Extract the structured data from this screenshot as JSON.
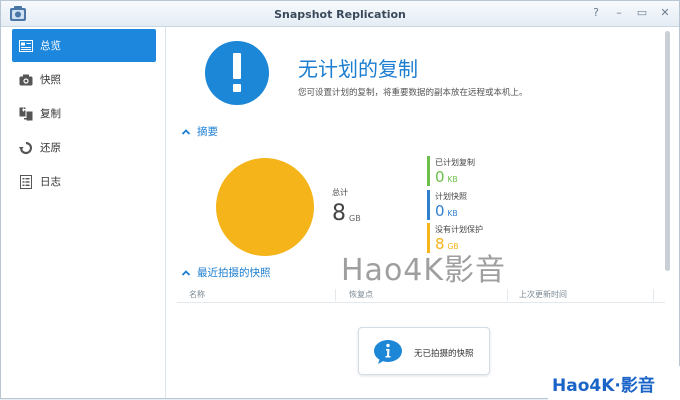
{
  "window": {
    "title": "Snapshot Replication"
  },
  "sidebar": {
    "items": [
      {
        "label": "总览",
        "icon": "overview-icon",
        "active": true
      },
      {
        "label": "快照",
        "icon": "camera-icon"
      },
      {
        "label": "复制",
        "icon": "replication-icon"
      },
      {
        "label": "还原",
        "icon": "restore-icon"
      },
      {
        "label": "日志",
        "icon": "log-icon"
      }
    ]
  },
  "hero": {
    "title": "无计划的复制",
    "subtitle": "您可设置计划的复制，将重要数据的副本放在远程或本机上。"
  },
  "summary": {
    "heading": "摘要",
    "total_label": "总计",
    "total_value": "8",
    "total_unit": "GB",
    "legend": [
      {
        "label": "已计划复制",
        "value": "0",
        "unit": "KB",
        "color": "#6cc04a"
      },
      {
        "label": "计划快照",
        "value": "0",
        "unit": "KB",
        "color": "#2f7fd0"
      },
      {
        "label": "没有计划保护",
        "value": "8",
        "unit": "GB",
        "color": "#f4b41a"
      }
    ]
  },
  "chart_data": {
    "type": "pie",
    "title": "",
    "slices": [
      {
        "name": "已计划复制",
        "value": 0
      },
      {
        "name": "计划快照",
        "value": 0
      },
      {
        "name": "没有计划保护",
        "value": 8
      }
    ],
    "colors": [
      "#6cc04a",
      "#2f7fd0",
      "#f4b41a"
    ]
  },
  "recent": {
    "heading": "最近拍摄的快照",
    "columns": [
      "名称",
      "恢复点",
      "上次更新时间"
    ],
    "empty_text": "无已拍摄的快照"
  },
  "watermark": {
    "text": "Hao4K影音"
  },
  "badge": {
    "text": "Hao4K·影音"
  },
  "colors": {
    "accent": "#1d87de",
    "pie_fill": "#f4b41a"
  }
}
